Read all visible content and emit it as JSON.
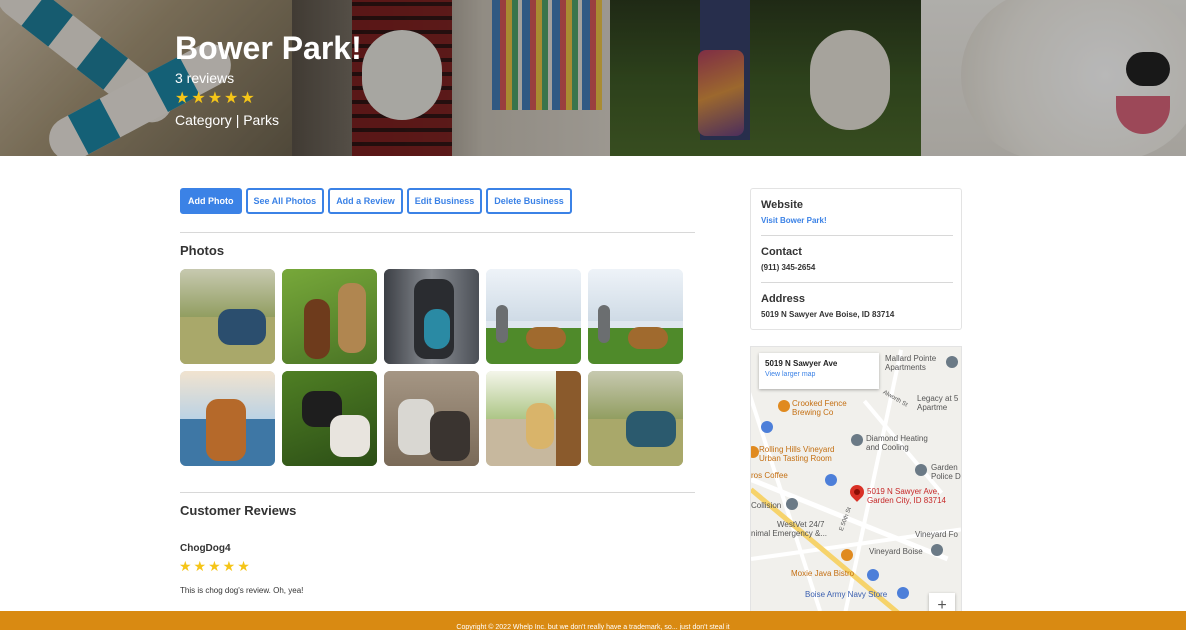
{
  "business": {
    "title": "Bower Park!",
    "review_count": "3 reviews",
    "rating": 5,
    "stars": "★★★★★",
    "category": "Category | Parks"
  },
  "actions": {
    "add_photo": "Add Photo",
    "see_all_photos": "See All Photos",
    "add_review": "Add a Review",
    "edit_business": "Edit Business",
    "delete_business": "Delete Business"
  },
  "photos_section": {
    "title": "Photos"
  },
  "reviews_section": {
    "title": "Customer Reviews",
    "reviews": [
      {
        "author": "ChogDog4",
        "rating": 5,
        "stars": "★★★★★",
        "text": "This is chog dog's review. Oh, yea!"
      }
    ]
  },
  "sidebar": {
    "website_label": "Website",
    "website_link": "Visit Bower Park!",
    "contact_label": "Contact",
    "phone": "(911) 345-2654",
    "address_label": "Address",
    "address": "5019 N Sawyer Ave Boise, ID 83714"
  },
  "map": {
    "card_title": "5019 N Sawyer Ave",
    "card_link": "View larger map",
    "pin_label_1": "5019 N Sawyer Ave,",
    "pin_label_2": "Garden City, ID 83714",
    "poi_mallard_1": "Mallard Pointe",
    "poi_mallard_2": "Apartments",
    "poi_legacy_1": "Legacy at 5",
    "poi_legacy_2": "Apartme",
    "poi_crooked_1": "Crooked Fence",
    "poi_crooked_2": "Brewing Co",
    "poi_diamond_1": "Diamond Heating",
    "poi_diamond_2": "and Cooling",
    "poi_rolling_1": "Rolling Hills Vineyard",
    "poi_rolling_2": "Urban Tasting Room",
    "poi_garden_1": "Garden",
    "poi_garden_2": "Police D",
    "poi_ros": "ros Coffee",
    "poi_collision": "Collision",
    "poi_westvet_1": "WestVet 24/7",
    "poi_westvet_2": "nimal Emergency &...",
    "poi_vineyard_fo": "Vineyard Fo",
    "poi_vineyard_boise": "Vineyard Boise",
    "poi_moxie": "Moxie Java Bistro",
    "poi_navy": "Boise Army Navy Store",
    "street_alworth": "Alworth St",
    "street_50th": "E 50th St",
    "zoom": "+"
  },
  "footer": {
    "text": "Copyright © 2022 Whelp Inc. but we don't really have a trademark, so... just don't steal it"
  },
  "colors": {
    "accent": "#3b82e6",
    "star": "#f5c518",
    "footer": "#d98a12"
  }
}
